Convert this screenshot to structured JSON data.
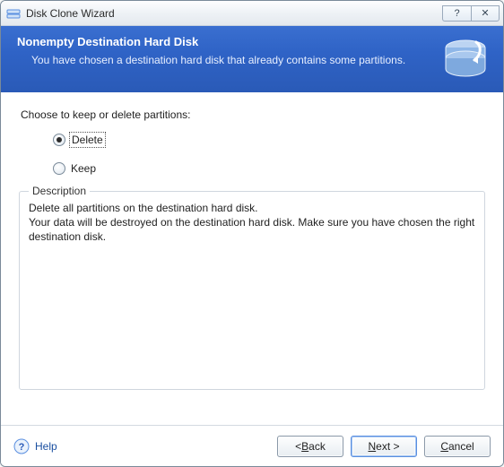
{
  "titlebar": {
    "title": "Disk Clone Wizard",
    "help_btn": "?",
    "close_btn": "✕"
  },
  "banner": {
    "heading": "Nonempty Destination Hard Disk",
    "subhead": "You have chosen a destination hard disk that already contains some partitions."
  },
  "content": {
    "prompt": "Choose to keep or delete partitions:",
    "options": {
      "delete": {
        "label": "Delete",
        "checked": true
      },
      "keep": {
        "label": "Keep",
        "checked": false
      }
    },
    "description_legend": "Description",
    "description_text": "Delete all partitions on the destination hard disk.\nYour data will be destroyed on the destination hard disk. Make sure you have chosen the right destination disk."
  },
  "footer": {
    "help_label": "Help",
    "back_prefix": "< ",
    "back_mnemonic": "B",
    "back_suffix": "ack",
    "next_mnemonic": "N",
    "next_suffix": "ext >",
    "cancel_mnemonic": "C",
    "cancel_suffix": "ancel"
  }
}
